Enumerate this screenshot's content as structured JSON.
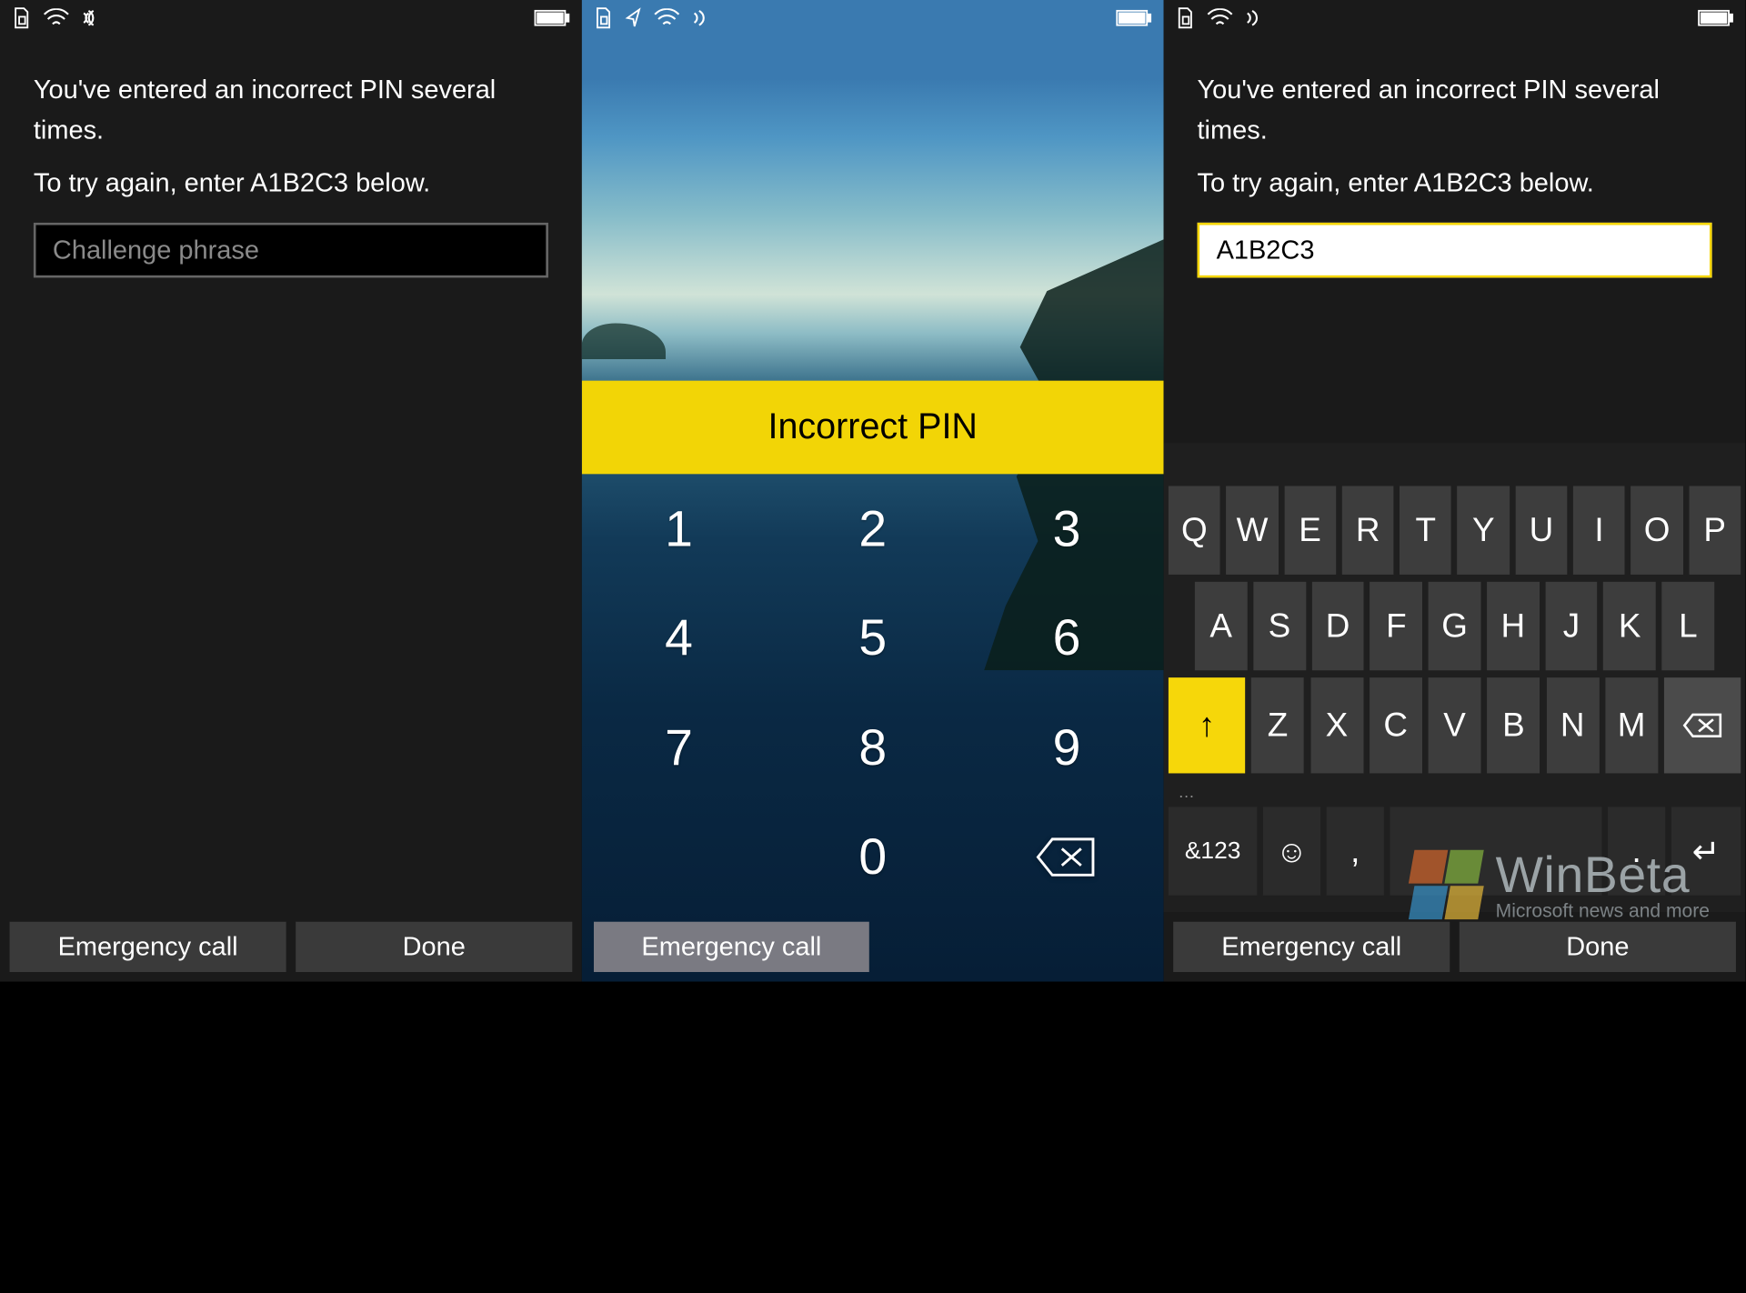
{
  "status": {
    "icons": [
      "sim-icon",
      "wifi-icon",
      "vibrate-icon"
    ],
    "battery": "battery-icon"
  },
  "screen1": {
    "line1": "You've entered an incorrect PIN several times.",
    "line2": "To try again, enter A1B2C3 below.",
    "placeholder": "Challenge phrase",
    "value": "",
    "emergency": "Emergency call",
    "done": "Done"
  },
  "screen2": {
    "banner": "Incorrect PIN",
    "keys": [
      "1",
      "2",
      "3",
      "4",
      "5",
      "6",
      "7",
      "8",
      "9",
      "0"
    ],
    "backspace": "backspace",
    "emergency": "Emergency call"
  },
  "screen3": {
    "line1": "You've entered an incorrect PIN several times.",
    "line2": "To try again, enter A1B2C3 below.",
    "value": "A1B2C3",
    "emergency": "Emergency call",
    "done": "Done",
    "kb": {
      "row1": [
        "Q",
        "W",
        "E",
        "R",
        "T",
        "Y",
        "U",
        "I",
        "O",
        "P"
      ],
      "row2": [
        "A",
        "S",
        "D",
        "F",
        "G",
        "H",
        "J",
        "K",
        "L"
      ],
      "row3": [
        "Z",
        "X",
        "C",
        "V",
        "B",
        "N",
        "M"
      ],
      "shift": "↑",
      "backspace": "⌫",
      "sym": "&123",
      "emoji": "☺",
      "comma": ",",
      "period": ".",
      "enter": "↵",
      "ellipsis": "…"
    }
  },
  "watermark": {
    "title": "WinBeta",
    "sub": "Microsoft news and more"
  },
  "colors": {
    "accent": "#f2d506",
    "dark": "#1a1a1a"
  }
}
